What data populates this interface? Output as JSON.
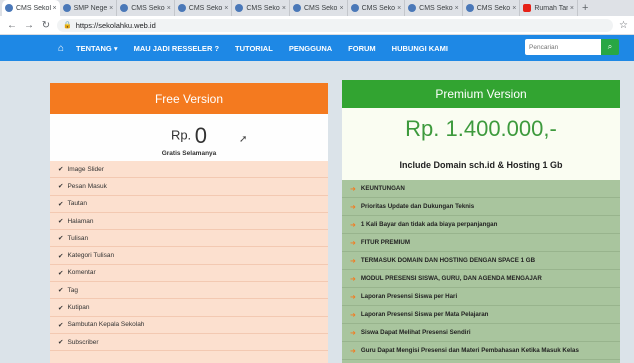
{
  "browser": {
    "tabs": [
      {
        "title": "CMS Sekolah",
        "active": true
      },
      {
        "title": "SMP Negeri"
      },
      {
        "title": "CMS Sekolah"
      },
      {
        "title": "CMS Sekolah"
      },
      {
        "title": "CMS Sekolah"
      },
      {
        "title": "CMS Sekolah"
      },
      {
        "title": "CMS Sekolah"
      },
      {
        "title": "CMS Sekolah"
      },
      {
        "title": "CMS Sekolah"
      },
      {
        "title": "Rumah Tangga"
      }
    ],
    "new_tab": "+",
    "url": "https://sekolahku.web.id"
  },
  "navbar": {
    "links": [
      "TENTANG ▾",
      "MAU JADI RESSELER ?",
      "TUTORIAL",
      "PENGGUNA",
      "FORUM",
      "HUBUNGI KAMI"
    ],
    "search_placeholder": "Pencarian"
  },
  "free": {
    "title": "Free Version",
    "price_currency": "Rp.",
    "price_value": "0",
    "subtitle": "Gratis Selamanya",
    "features": [
      "Image Slider",
      "Pesan Masuk",
      "Tautan",
      "Halaman",
      "Tulisan",
      "Kategori Tulisan",
      "Komentar",
      "Tag",
      "Kutipan",
      "Sambutan Kepala Sekolah",
      "Subscriber"
    ]
  },
  "premium": {
    "title": "Premium Version",
    "price": "Rp. 1.400.000,-",
    "subtitle": "Include Domain sch.id & Hosting 1 Gb",
    "features": [
      "KEUNTUNGAN",
      "Prioritas Update dan Dukungan Teknis",
      "1 Kali Bayar dan tidak ada biaya perpanjangan",
      "FITUR PREMIUM",
      "TERMASUK DOMAIN DAN HOSTING DENGAN SPACE 1 GB",
      "MODUL PRESENSI SISWA, GURU, DAN AGENDA MENGAJAR",
      "Laporan Presensi Siswa per Hari",
      "Laporan Presensi Siswa per Mata Pelajaran",
      "Siswa Dapat Melihat Presensi Sendiri",
      "Guru Dapat Mengisi Presensi dan Materi Pembahasan Ketika Masuk Kelas"
    ]
  }
}
